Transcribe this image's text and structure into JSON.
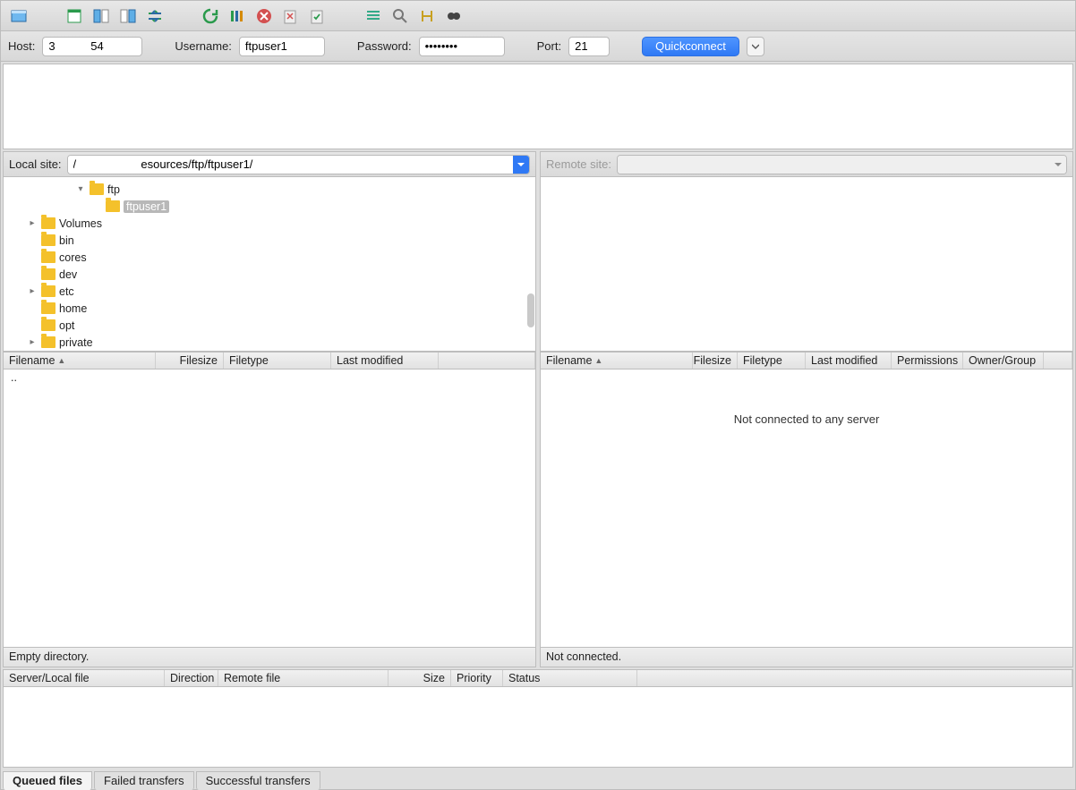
{
  "toolbar": {
    "icons": [
      "site-manager",
      "new-tab",
      "compare",
      "sync-browse",
      "refresh",
      "filter",
      "cancel",
      "disconnect",
      "reconnect",
      "queue-process",
      "search-remote",
      "swap",
      "find"
    ]
  },
  "quickconnect": {
    "host_label": "Host:",
    "host_value": "3           54",
    "user_label": "Username:",
    "user_value": "ftpuser1",
    "pass_label": "Password:",
    "pass_value": "••••••••",
    "port_label": "Port:",
    "port_value": "21",
    "button_label": "Quickconnect"
  },
  "local": {
    "site_label": "Local site:",
    "path": "/                    esources/ftp/ftpuser1/",
    "tree": [
      {
        "indent": 4,
        "twisty": "▾",
        "label": "ftp"
      },
      {
        "indent": 5,
        "twisty": "",
        "label": "ftpuser1",
        "selected": true
      },
      {
        "indent": 1,
        "twisty": "▸",
        "label": "Volumes"
      },
      {
        "indent": 1,
        "twisty": "",
        "label": "bin"
      },
      {
        "indent": 1,
        "twisty": "",
        "label": "cores"
      },
      {
        "indent": 1,
        "twisty": "",
        "label": "dev"
      },
      {
        "indent": 1,
        "twisty": "▸",
        "label": "etc"
      },
      {
        "indent": 1,
        "twisty": "",
        "label": "home"
      },
      {
        "indent": 1,
        "twisty": "",
        "label": "opt"
      },
      {
        "indent": 1,
        "twisty": "▸",
        "label": "private"
      }
    ],
    "columns": [
      "Filename",
      "Filesize",
      "Filetype",
      "Last modified"
    ],
    "parent_row": "..",
    "status": "Empty directory."
  },
  "remote": {
    "site_label": "Remote site:",
    "columns": [
      "Filename",
      "Filesize",
      "Filetype",
      "Last modified",
      "Permissions",
      "Owner/Group"
    ],
    "centered_message": "Not connected to any server",
    "status": "Not connected."
  },
  "queue": {
    "columns": [
      "Server/Local file",
      "Direction",
      "Remote file",
      "Size",
      "Priority",
      "Status"
    ],
    "tabs": [
      "Queued files",
      "Failed transfers",
      "Successful transfers"
    ],
    "active_tab": 0
  }
}
